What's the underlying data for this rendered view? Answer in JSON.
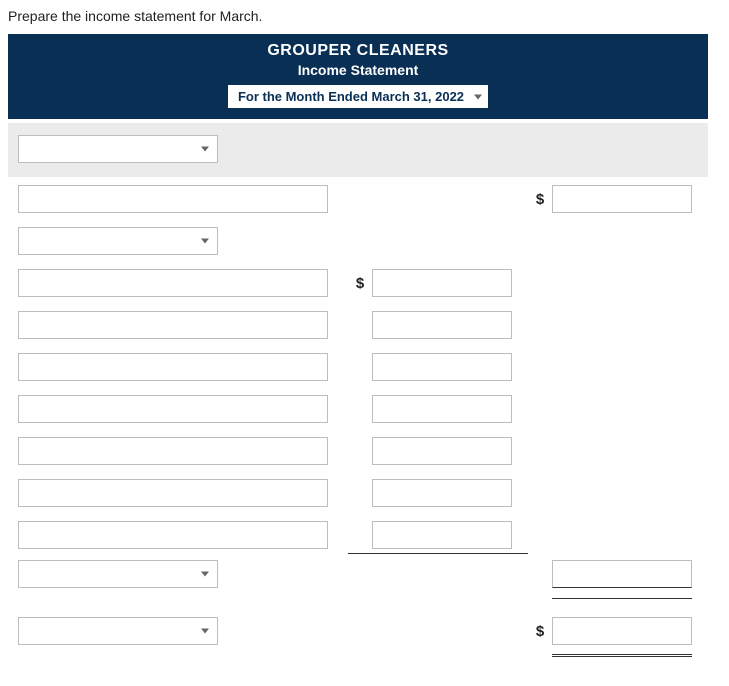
{
  "instruction": "Prepare the income statement for March.",
  "header": {
    "company": "GROUPER CLEANERS",
    "statement": "Income Statement",
    "period": "For the Month Ended March 31, 2022"
  },
  "currency_symbol": "$",
  "colors": {
    "brand_blue": "#0a2f55"
  }
}
